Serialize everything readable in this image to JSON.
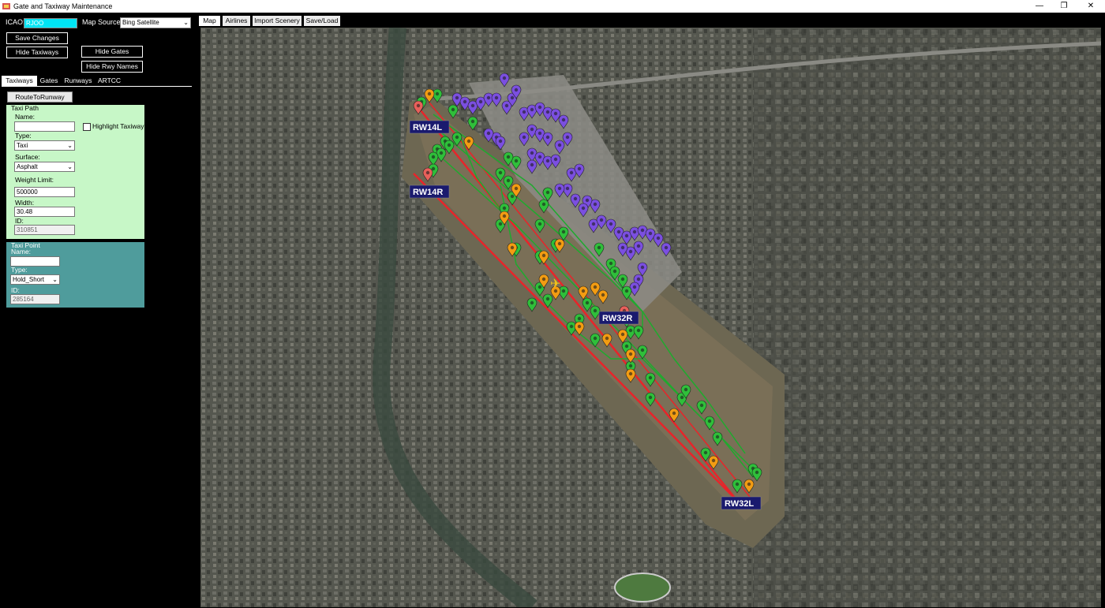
{
  "window": {
    "title": "Gate and Taxiway Maintenance",
    "minimize": "—",
    "restore": "❐",
    "close": "✕"
  },
  "top": {
    "icao_label": "ICAO:",
    "icao_value": "RJOO",
    "map_source_label": "Map Source:",
    "map_source_value": "Bing Satellite",
    "save_changes": "Save Changes",
    "hide_taxiways": "Hide Taxiways",
    "hide_gates": "Hide Gates",
    "hide_rwy_names": "Hide Rwy Names"
  },
  "left_tabs": [
    "Taxiways",
    "Gates",
    "Runways",
    "ARTCC"
  ],
  "route_to_runway": "RouteToRunway",
  "taxi_path": {
    "title": "Taxi Path",
    "name_label": "Name:",
    "name_value": "",
    "highlight_label": "Highlight Taxiway",
    "type_label": "Type:",
    "type_value": "Taxi",
    "surface_label": "Surface:",
    "surface_value": "Asphalt",
    "weight_label": "Weight Limit:",
    "weight_value": "500000",
    "width_label": "Width:",
    "width_value": "30.48",
    "id_label": "ID:",
    "id_value": "310851"
  },
  "taxi_point": {
    "title": "Taxi Point",
    "name_label": "Name:",
    "name_value": "",
    "type_label": "Type:",
    "type_value": "Hold_Short",
    "id_label": "ID:",
    "id_value": "285164"
  },
  "map_tabs": [
    "Map",
    "Airlines",
    "Import Scenery",
    "Save/Load"
  ],
  "runway_labels": [
    "RW14L",
    "RW14R",
    "RW32R",
    "RW32L"
  ],
  "colors": {
    "gate_marker": "#7b4fe0",
    "taxi_marker": "#2fbf3a",
    "hold_short_marker": "#f39c12",
    "runway_marker": "#e8605a",
    "runway_line": "#e8242a",
    "taxiway_line": "#1faa2e",
    "runway_label_bg": "#1a1a6e"
  }
}
